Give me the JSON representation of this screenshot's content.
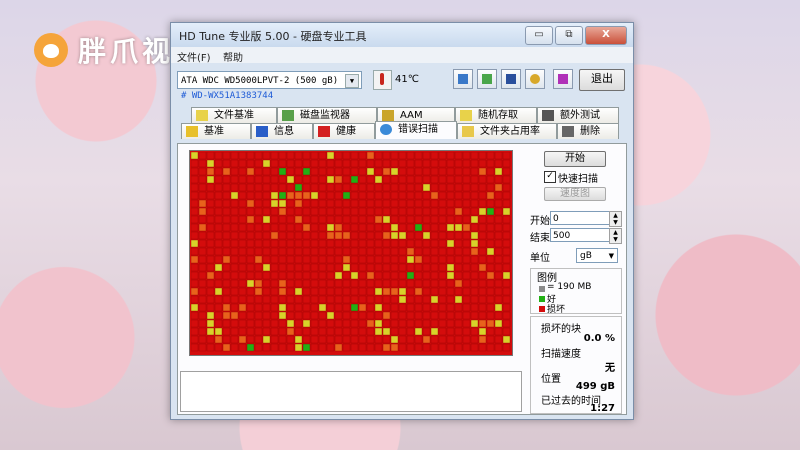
{
  "watermark": {
    "text": "胖爪视频"
  },
  "window": {
    "title": "HD Tune 专业版 5.00 - 硬盘专业工具",
    "menu": [
      "文件(F)",
      "帮助"
    ],
    "controls": {
      "minimize": "▭",
      "restore": "⧉",
      "close": "X"
    }
  },
  "toolbar": {
    "drive": "ATA   WDC WD5000LPVT-2 (500 gB)",
    "serial": "#    WD-WX51A1383744",
    "temperature": "41℃",
    "exit_label": "退出"
  },
  "tabs": {
    "row1": [
      "文件基准",
      "磁盘监视器",
      "AAM",
      "随机存取",
      "额外测试"
    ],
    "row2": [
      "基准",
      "信息",
      "健康",
      "错误扫描",
      "文件夹占用率",
      "删除"
    ],
    "active": "错误扫描"
  },
  "scan": {
    "start_label": "开始",
    "quick_scan_label": "快速扫描",
    "quick_scan_checked": true,
    "speed_map_label": "速度图",
    "start_field_label": "开始",
    "start_value": "0",
    "end_field_label": "结束",
    "end_value": "500",
    "unit_label": "单位",
    "unit_value": "gB",
    "legend_title": "图例",
    "legend_block": "= 190 MB",
    "legend_good": "好",
    "legend_bad": "损坏",
    "damaged_blocks_label": "损坏的块",
    "damaged_blocks_value": "0.0 %",
    "scan_speed_label": "扫描速度",
    "scan_speed_value": "无",
    "position_label": "位置",
    "position_value": "499 gB",
    "elapsed_label": "已过去的时间",
    "elapsed_value": "1:27"
  },
  "colors": {
    "bad": "#d40c0c",
    "good": "#22b014",
    "warn_yellow": "#d8d22a",
    "warn_orange": "#e8621c",
    "accent": "#1e5bd6"
  }
}
